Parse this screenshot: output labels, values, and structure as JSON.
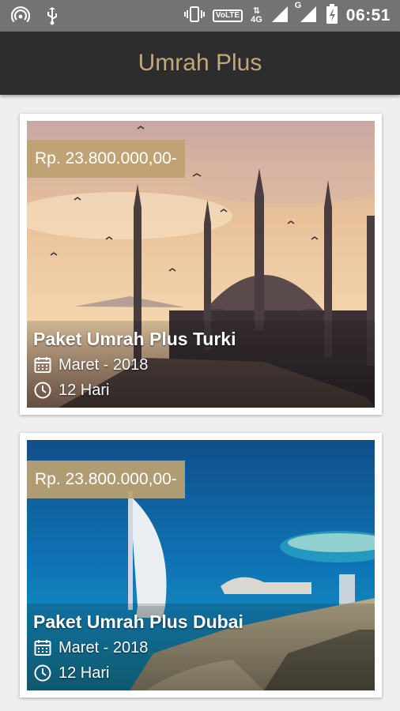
{
  "status_bar": {
    "network_4g": "4G",
    "network_g": "G",
    "volte": "VoLTE",
    "time": "06:51",
    "icons": [
      "hotspot-icon",
      "usb-icon",
      "vibrate-icon",
      "volte-icon",
      "data-arrows-icon",
      "signal-icon",
      "battery-charging-icon"
    ]
  },
  "appbar": {
    "title": "Umrah Plus"
  },
  "packages": [
    {
      "price": "Rp. 23.800.000,00-",
      "name": "Paket Umrah Plus Turki",
      "date": "Maret - 2018",
      "duration": "12 Hari",
      "image": "blue-mosque-istanbul-sunset"
    },
    {
      "price": "Rp. 23.800.000,00-",
      "name": "Paket Umrah Plus Dubai",
      "date": "Maret - 2018",
      "duration": "12 Hari",
      "image": "burj-al-arab-dubai-coast"
    }
  ],
  "colors": {
    "appbar": "#2d2d2d",
    "title": "#c2a77a",
    "price_badge": "#bea270",
    "statusbar": "#737373"
  }
}
